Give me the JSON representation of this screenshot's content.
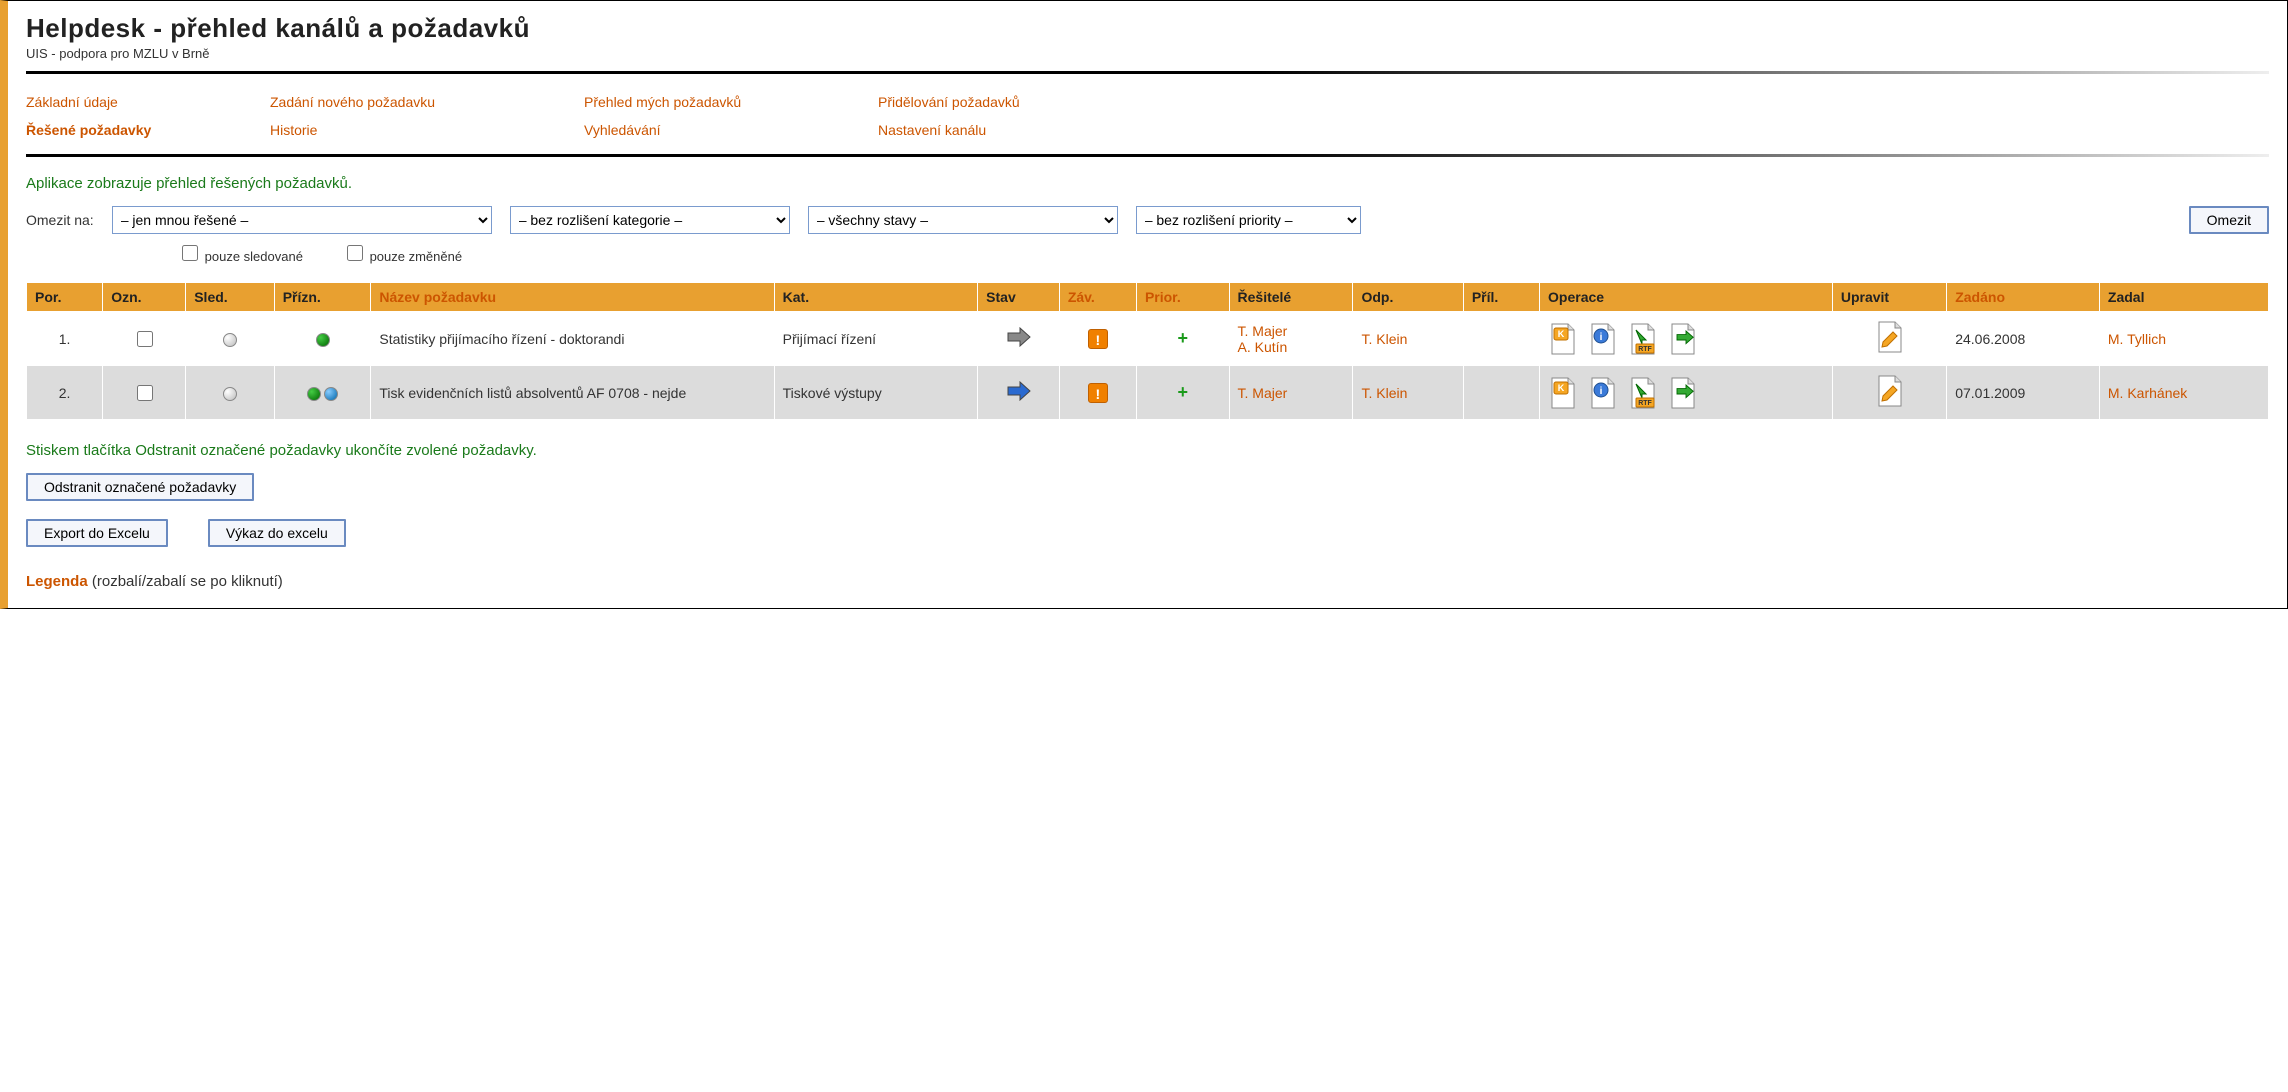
{
  "header": {
    "title": "Helpdesk - přehled kanálů a požadavků",
    "subtitle": "UIS - podpora pro MZLU v Brně"
  },
  "nav": {
    "row1": [
      "Základní údaje",
      "Zadání nového požadavku",
      "Přehled mých požadavků",
      "Přidělování požadavků"
    ],
    "row2": [
      "Řešené požadavky",
      "Historie",
      "Vyhledávání",
      "Nastavení kanálu"
    ],
    "active": "Řešené požadavky"
  },
  "intro": "Aplikace zobrazuje přehled řešených požadavků.",
  "filters": {
    "label": "Omezit na:",
    "sel1": "– jen mnou řešené –",
    "sel2": "– bez rozlišení kategorie –",
    "sel3": "– všechny stavy –",
    "sel4": "– bez rozlišení priority –",
    "submit": "Omezit",
    "chk1": "pouze sledované",
    "chk2": "pouze změněné"
  },
  "table": {
    "headers": {
      "por": "Por.",
      "ozn": "Ozn.",
      "sled": "Sled.",
      "prizn": "Přízn.",
      "nazev": "Název požadavku",
      "kat": "Kat.",
      "stav": "Stav",
      "zav": "Záv.",
      "prior": "Prior.",
      "resitele": "Řešitelé",
      "odp": "Odp.",
      "pril": "Příl.",
      "operace": "Operace",
      "upravit": "Upravit",
      "zadano": "Zadáno",
      "zadal": "Zadal"
    },
    "rows": [
      {
        "por": "1.",
        "nazev": "Statistiky přijímacího řízení - doktorandi",
        "kat": "Přijímací řízení",
        "stav_arrow": "grey",
        "resitele": [
          "T. Majer",
          "A. Kutín"
        ],
        "odp": "T. Klein",
        "zadano": "24.06.2008",
        "zadal": "M. Tyllich",
        "prizn_dots": [
          "green"
        ]
      },
      {
        "por": "2.",
        "nazev": "Tisk evidenčních listů absolventů AF 0708 - nejde",
        "kat": "Tiskové výstupy",
        "stav_arrow": "blue",
        "resitele": [
          "T. Majer"
        ],
        "odp": "T. Klein",
        "zadano": "07.01.2009",
        "zadal": "M. Karhánek",
        "prizn_dots": [
          "green",
          "blue"
        ]
      }
    ]
  },
  "notice": "Stiskem tlačítka Odstranit označené požadavky ukončíte zvolené požadavky.",
  "buttons": {
    "remove": "Odstranit označené požadavky",
    "export_excel": "Export do Excelu",
    "vykaz_excel": "Výkaz do excelu"
  },
  "legend": {
    "label": "Legenda",
    "hint": "(rozbalí/zabalí se po kliknutí)"
  }
}
